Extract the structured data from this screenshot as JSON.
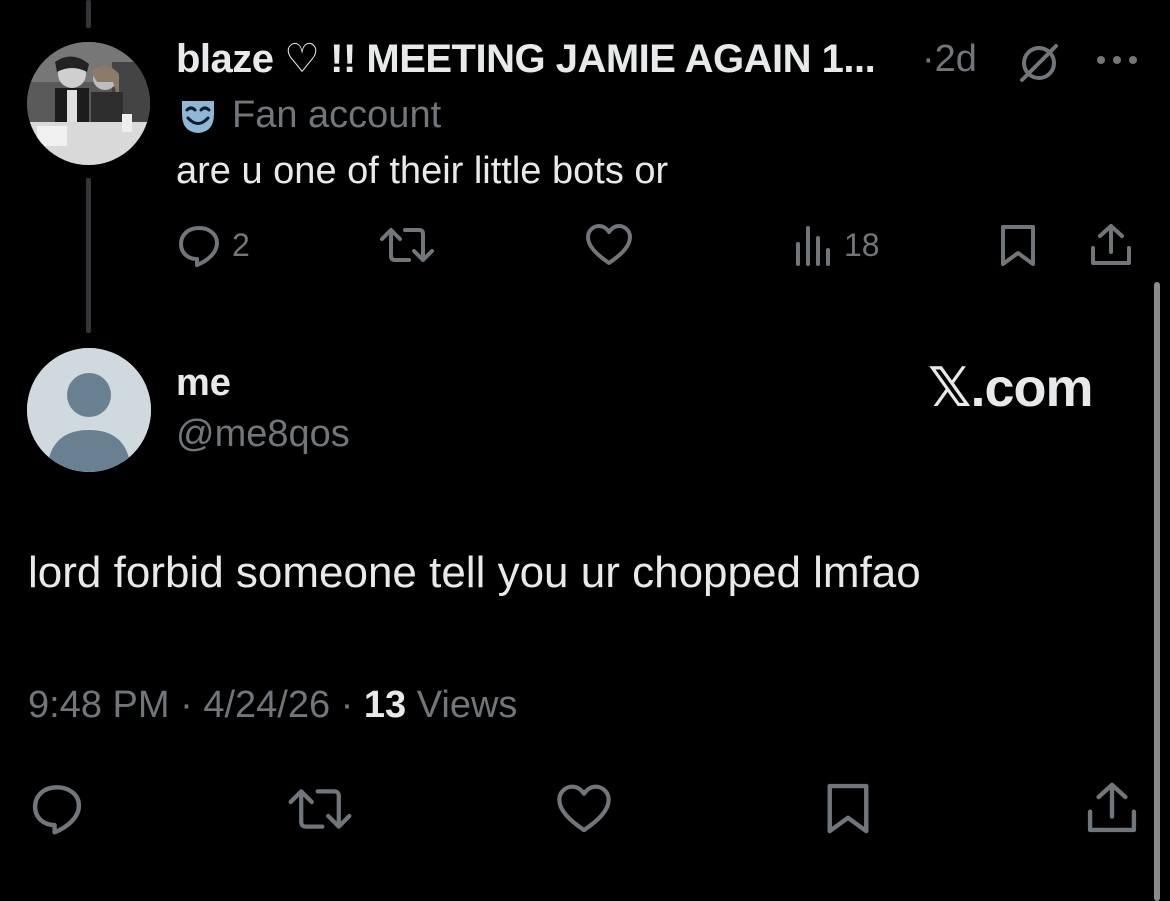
{
  "parent_tweet": {
    "display_name": "blaze ♡ !! MEETING JAMIE AGAIN 1...",
    "separator": "·",
    "age": "2d",
    "label": "Fan account",
    "text": "are u one of their little bots or",
    "reply_count": "2",
    "view_count": "18"
  },
  "focused_tweet": {
    "display_name": "me",
    "handle": "@me8qos",
    "brand": "𝕏.com",
    "text": "lord forbid someone tell you ur chopped lmfao",
    "time": "9:48 PM",
    "sep1": "·",
    "date": "4/24/26",
    "sep2": "·",
    "views_count": "13",
    "views_label": "Views"
  },
  "icons": {
    "grok": "grok-icon",
    "more": "more-icon",
    "label_badge": "theater-mask-icon",
    "reply": "reply-icon",
    "retweet": "retweet-icon",
    "like": "like-icon",
    "views": "views-icon",
    "bookmark": "bookmark-icon",
    "share": "share-icon"
  },
  "colors": {
    "background": "#000000",
    "primary_text": "#e7e9ea",
    "secondary_text": "#71767b",
    "badge": "#8fb8d6"
  }
}
